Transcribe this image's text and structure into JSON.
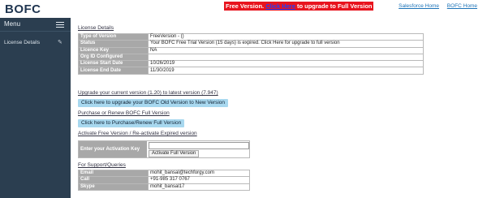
{
  "brand": "BOFC",
  "banner": {
    "prefix": "Free Version. ",
    "link": "Click Here",
    "suffix": " to upgrade to Full Version"
  },
  "toplinks": [
    "Salesforce Home",
    "BOFC Home"
  ],
  "sidebar": {
    "menu_label": "Menu",
    "items": [
      {
        "label": "License Details",
        "icon": "pencil-icon"
      }
    ]
  },
  "license": {
    "title": "License Details",
    "rows": [
      {
        "key": "Type of Version",
        "value": "FreeVersion - ()"
      },
      {
        "key": "Status",
        "value": "Your BOFC Free Trial Version (15 days) is expired. Click Here for upgrade to full version"
      },
      {
        "key": "Licence Key",
        "value": "NA"
      },
      {
        "key": "Org ID Configured",
        "value": ""
      },
      {
        "key": "License Start Date",
        "value": "10/26/2019"
      },
      {
        "key": "License End Date",
        "value": "11/30/2019"
      }
    ]
  },
  "upgrade": {
    "title": "Upgrade your current version (1.20) to latest version (7.947)",
    "button": "Click here to upgrade your BOFC Old Version to New Version"
  },
  "purchase": {
    "title": "Purchase or Renew BOFC Full Version",
    "button": "Click here to Purchase/Renew Full Version"
  },
  "activate": {
    "title": "Activate Free Version / Re-activate Expired version",
    "label": "Enter your Activation Key",
    "input_value": "",
    "button": "Activate Full Version"
  },
  "support": {
    "title": "For Support/Queries",
    "rows": [
      {
        "key": "Email",
        "value": "mohit_bansal@techforgy.com"
      },
      {
        "key": "Call",
        "value": "+91-985 317 0767"
      },
      {
        "key": "Skype",
        "value": "mohit_bansal17"
      }
    ]
  }
}
